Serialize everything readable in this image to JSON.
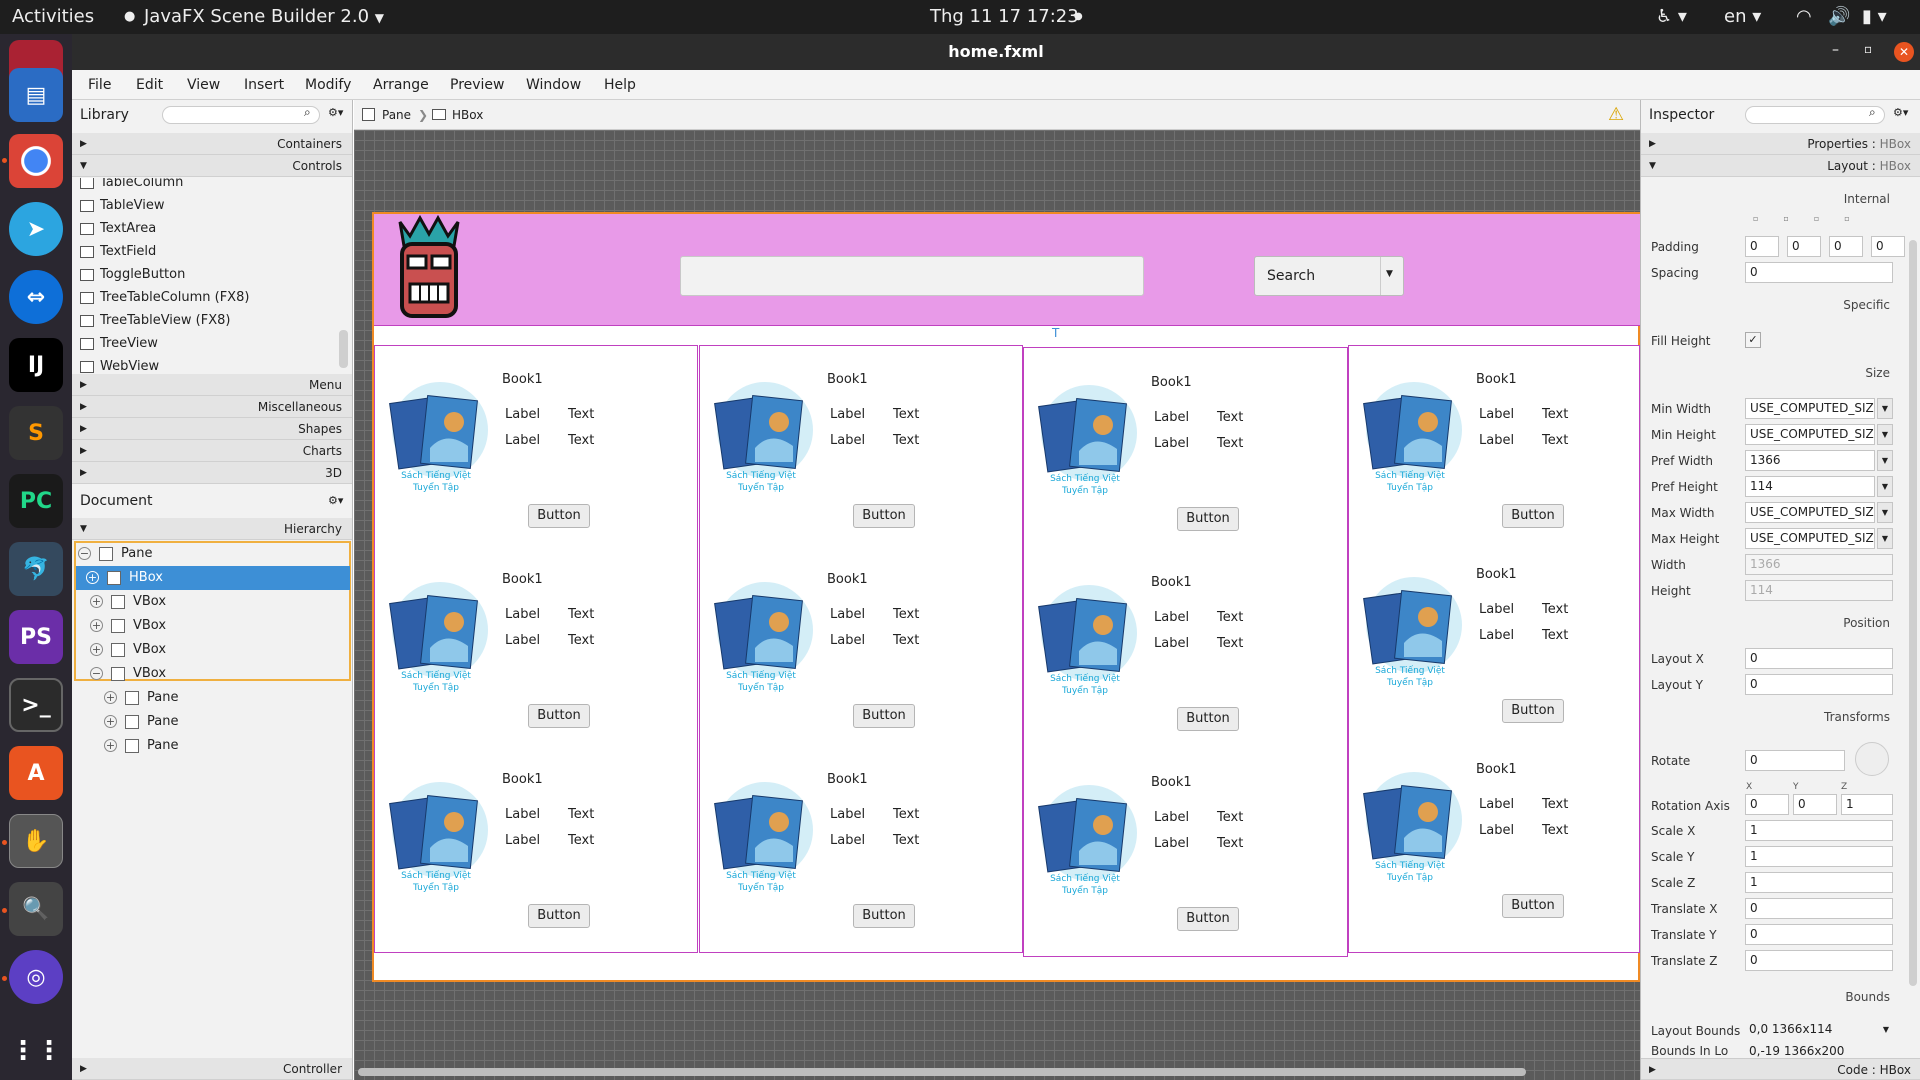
{
  "topbar": {
    "activities": "Activities",
    "app_name": "JavaFX Scene Builder 2.0",
    "datetime": "Thg 11 17  17:23",
    "lang": "en"
  },
  "window": {
    "title": "home.fxml"
  },
  "menu": [
    "File",
    "Edit",
    "View",
    "Insert",
    "Modify",
    "Arrange",
    "Preview",
    "Window",
    "Help"
  ],
  "library": {
    "title": "Library",
    "sections_top": [
      "Containers",
      "Controls"
    ],
    "items": [
      "TableColumn",
      "TableView",
      "TextArea",
      "TextField",
      "ToggleButton",
      "TreeTableColumn  (FX8)",
      "TreeTableView  (FX8)",
      "TreeView",
      "WebView"
    ],
    "sections_bottom": [
      "Menu",
      "Miscellaneous",
      "Shapes",
      "Charts",
      "3D"
    ]
  },
  "document": {
    "title": "Document",
    "hierarchy_label": "Hierarchy",
    "tree": [
      "Pane",
      "HBox",
      "VBox",
      "VBox",
      "VBox",
      "VBox",
      "Pane",
      "Pane",
      "Pane"
    ],
    "controller": "Controller"
  },
  "breadcrumb": {
    "items": [
      "Pane",
      "HBox"
    ]
  },
  "design": {
    "search_button": "Search",
    "book_title": "Book1",
    "label": "Label",
    "text": "Text",
    "button": "Button",
    "cover_caption_1": "Sách Tiếng Việt",
    "cover_caption_2": "Tuyển Tập"
  },
  "inspector": {
    "title": "Inspector",
    "properties": "Properties",
    "layout": "Layout",
    "node": "HBox",
    "internal": "Internal",
    "padding_label": "Padding",
    "padding": [
      "0",
      "0",
      "0",
      "0"
    ],
    "spacing_label": "Spacing",
    "spacing": "0",
    "specific": "Specific",
    "fill_height_label": "Fill Height",
    "size": "Size",
    "min_width_label": "Min Width",
    "min_width": "USE_COMPUTED_SIZ",
    "min_height_label": "Min Height",
    "min_height": "USE_COMPUTED_SIZ",
    "pref_width_label": "Pref Width",
    "pref_width": "1366",
    "pref_height_label": "Pref Height",
    "pref_height": "114",
    "max_width_label": "Max Width",
    "max_width": "USE_COMPUTED_SIZ",
    "max_height_label": "Max Height",
    "max_height": "USE_COMPUTED_SIZ",
    "width_label": "Width",
    "width": "1366",
    "height_label": "Height",
    "height": "114",
    "position": "Position",
    "layout_x_label": "Layout X",
    "layout_x": "0",
    "layout_y_label": "Layout Y",
    "layout_y": "0",
    "transforms": "Transforms",
    "rotate_label": "Rotate",
    "rotate": "0",
    "axis_x": "X",
    "axis_y": "Y",
    "axis_z": "Z",
    "rotation_axis_label": "Rotation Axis",
    "rotation_axis": [
      "0",
      "0",
      "1"
    ],
    "scale_x_label": "Scale X",
    "scale_x": "1",
    "scale_y_label": "Scale Y",
    "scale_y": "1",
    "scale_z_label": "Scale Z",
    "scale_z": "1",
    "translate_x_label": "Translate X",
    "translate_x": "0",
    "translate_y_label": "Translate Y",
    "translate_y": "0",
    "translate_z_label": "Translate Z",
    "translate_z": "0",
    "bounds": "Bounds",
    "layout_bounds_label": "Layout Bounds",
    "layout_bounds": "0,0  1366x114",
    "bounds_in_local_label": "Bounds In Lo",
    "bounds_in_local": "0,-19  1366x200",
    "code_footer": "Code : HBox"
  }
}
